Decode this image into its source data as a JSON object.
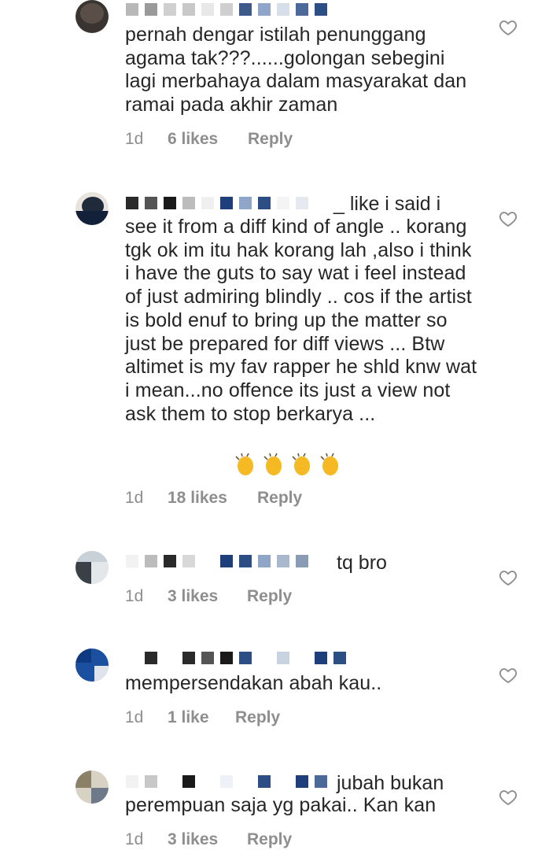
{
  "comments": [
    {
      "text": "pernah dengar istilah penunggang agama tak???......golongan sebegini lagi merbahaya dalam masyarakat dan ramai pada akhir zaman",
      "time": "1d",
      "likes": "6 likes",
      "reply": "Reply"
    },
    {
      "inline_text": "_ like i said i",
      "text": "see it from a diff kind of angle .. korang tgk ok im itu hak korang lah ,also i think i have the guts to say wat i feel instead of just admiring blindly .. cos if the artist is bold enuf to bring up the matter so just be prepared for diff views ... Btw altimet is my fav rapper he shld knw wat i mean...no offence its just a view not ask them to stop berkarya ...",
      "time": "1d",
      "likes": "18 likes",
      "reply": "Reply"
    },
    {
      "inline_text": "tq bro",
      "time": "1d",
      "likes": "3 likes",
      "reply": "Reply"
    },
    {
      "text": "mempersendakan abah kau..",
      "time": "1d",
      "likes": "1 like",
      "reply": "Reply"
    },
    {
      "inline_text": "jubah bukan",
      "text": "perempuan saja yg pakai.. Kan kan",
      "time": "1d",
      "likes": "3 likes",
      "reply": "Reply"
    }
  ],
  "icons": {
    "like": "heart-outline-icon",
    "emoji": "clapping-hands-emoji"
  },
  "colors": {
    "text": "#262626",
    "meta": "#8e8e8e"
  }
}
